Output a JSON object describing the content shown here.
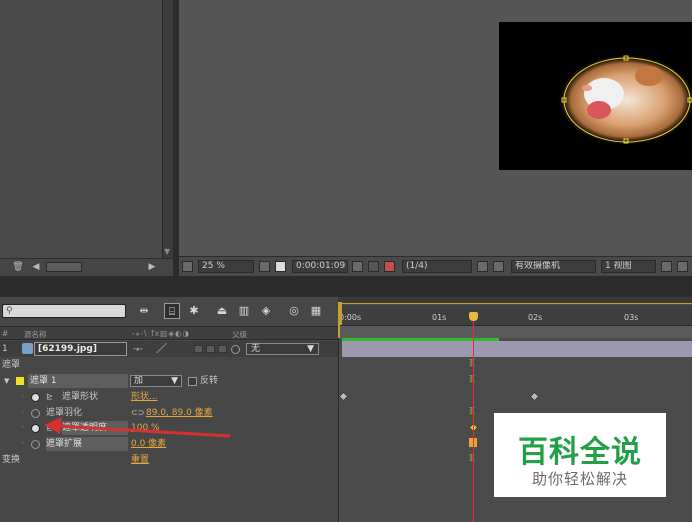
{
  "colors": {
    "accent_orange": "#e8a53c",
    "cti_red": "#e03030",
    "work_area_green": "#2fb92f",
    "layer_bar": "#9d98b0",
    "watermark_green": "#22a046"
  },
  "viewer": {
    "zoom": "25 %",
    "timecode": "0:00:01:09",
    "resolution": "(1/4)",
    "camera": "有效摄像机",
    "views": "1 视图"
  },
  "timeline": {
    "columns": {
      "num": "#",
      "source_name": "源名称",
      "parent": "父级"
    },
    "ruler": {
      "t0": "0:00s",
      "t1": "01s",
      "t2": "02s",
      "t3": "03s"
    },
    "layer": {
      "index": "1",
      "name": "[62199.jpg]",
      "parent_value": "无"
    },
    "group_masks": "遮罩",
    "mask": {
      "name": "遮罩 1",
      "mode": "加",
      "invert_label": "反转"
    },
    "props": [
      {
        "label": "遮罩形状",
        "value": "形状..."
      },
      {
        "label": "遮罩羽化",
        "value": "89.0, 89.0 像素"
      },
      {
        "label": "遮罩透明度",
        "value": "100 %"
      },
      {
        "label": "遮罩扩展",
        "value": "0.0 像素"
      }
    ],
    "transform": {
      "label": "变换",
      "value": "重置"
    }
  },
  "watermark": {
    "title": "百科全说",
    "subtitle": "助你轻松解决"
  }
}
